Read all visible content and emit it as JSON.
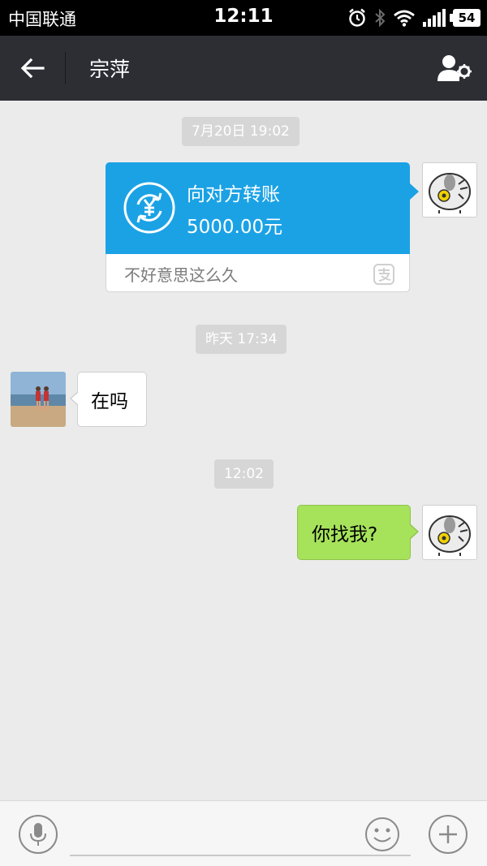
{
  "status_bar": {
    "carrier": "中国联通",
    "time": "12:11",
    "battery": "54",
    "icons": [
      "alarm-icon",
      "bluetooth-icon",
      "wifi-icon",
      "signal-icon",
      "battery-icon"
    ]
  },
  "header": {
    "title": "宗萍",
    "back_icon": "back-arrow-icon",
    "profile_icon": "contact-settings-icon",
    "background": "#2d2e34"
  },
  "messages": [
    {
      "type": "timestamp",
      "text": "7月20日 19:02"
    },
    {
      "type": "transfer",
      "from": "self",
      "title": "向对方转账",
      "amount": "5000.00元",
      "note": "不好意思这么久",
      "icon": "yuan-transfer-icon",
      "brand_icon": "alipay-icon",
      "color": "#1ba2e5"
    },
    {
      "type": "timestamp",
      "text": "昨天 17:34"
    },
    {
      "type": "text",
      "from": "other",
      "text": "在吗"
    },
    {
      "type": "timestamp",
      "text": "12:02"
    },
    {
      "type": "text",
      "from": "self",
      "text": "你找我?",
      "color": "#a6e35b"
    }
  ],
  "input_bar": {
    "value": "",
    "placeholder": "",
    "voice_icon": "microphone-icon",
    "emoji_icon": "smiley-icon",
    "more_icon": "plus-icon"
  },
  "colors": {
    "chat_background": "#ebebeb",
    "timestamp_background": "#d6d6d6"
  }
}
